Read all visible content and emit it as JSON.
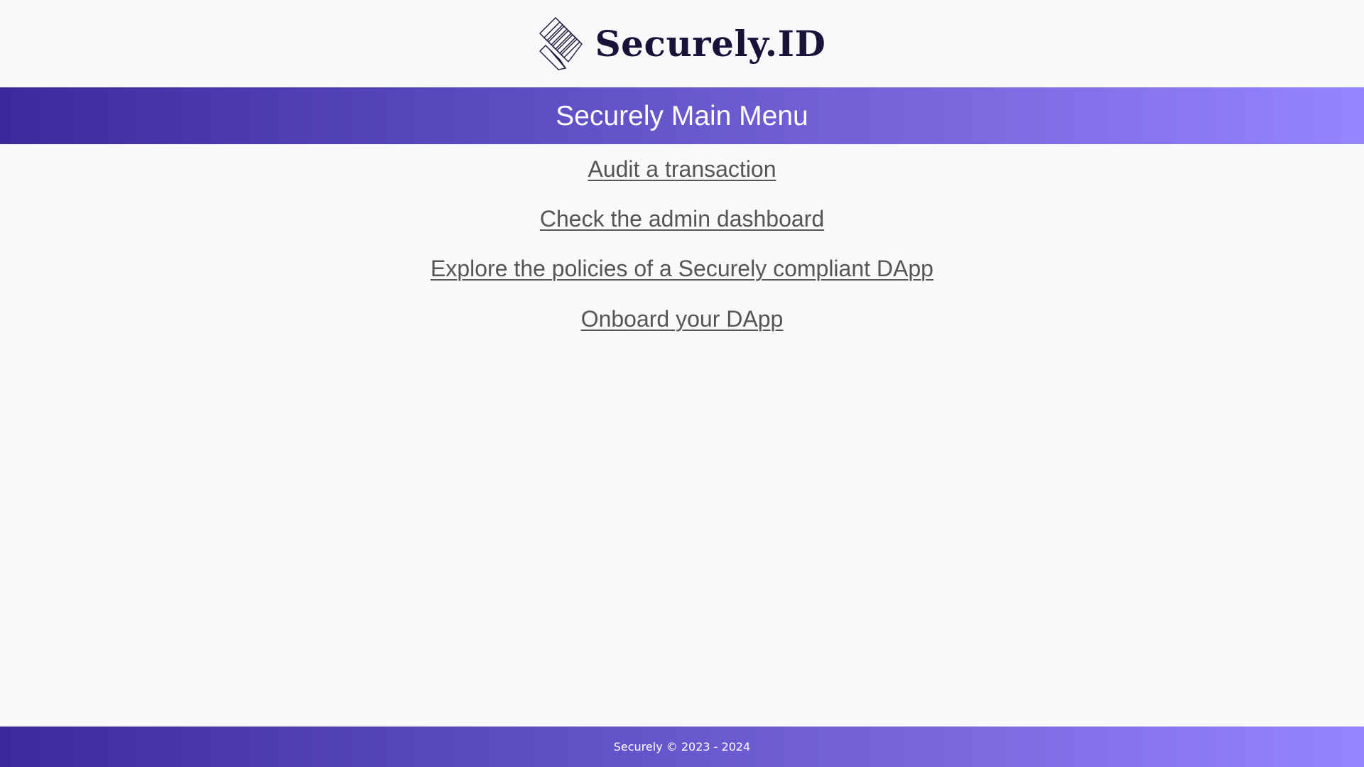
{
  "brand": {
    "logo_text": "Securely.ID",
    "logo_icon": "layered-diamond-logo-icon",
    "text_color": "#1a1238"
  },
  "header": {
    "title": "Securely Main Menu",
    "gradient_start": "#3b2a9b",
    "gradient_end": "#9585ff"
  },
  "menu": {
    "items": [
      {
        "label": "Audit a transaction"
      },
      {
        "label": "Check the admin dashboard"
      },
      {
        "label": "Explore the policies of a Securely compliant DApp"
      },
      {
        "label": "Onboard your DApp"
      }
    ],
    "link_color": "#555555"
  },
  "footer": {
    "text": "Securely © 2023 - 2024"
  },
  "colors": {
    "background": "#f8f9fa"
  }
}
